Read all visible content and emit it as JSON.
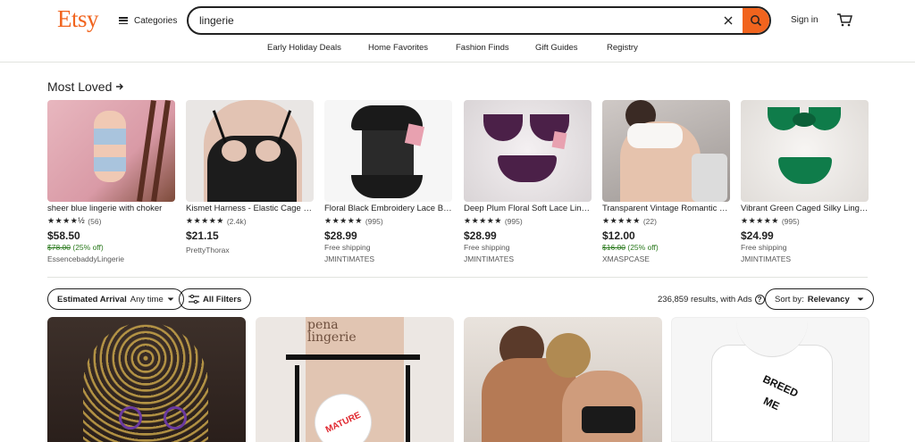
{
  "header": {
    "logo": "Etsy",
    "categories_label": "Categories",
    "search_value": "lingerie",
    "signin_label": "Sign in",
    "nav": [
      "Early Holiday Deals",
      "Home Favorites",
      "Fashion Finds",
      "Gift Guides",
      "Registry"
    ]
  },
  "most_loved": {
    "title": "Most Loved",
    "items": [
      {
        "title": "sheer blue lingerie with choker",
        "stars": "★★★★½",
        "reviews": "(56)",
        "price": "$58.50",
        "original_price": "$78.00",
        "discount": "(25% off)",
        "shipping": "",
        "shop": "EssencebaddyLingerie"
      },
      {
        "title": "Kismet Harness - Elastic Cage Bra",
        "stars": "★★★★★",
        "reviews": "(2.4k)",
        "price": "$21.15",
        "original_price": "",
        "discount": "",
        "shipping": "",
        "shop": "PrettyThorax"
      },
      {
        "title": "Floral Black Embroidery Lace Bodysuit",
        "stars": "★★★★★",
        "reviews": "(995)",
        "price": "$28.99",
        "original_price": "",
        "discount": "",
        "shipping": "Free shipping",
        "shop": "JMINTIMATES"
      },
      {
        "title": "Deep Plum Floral Soft Lace Lingerie Set",
        "stars": "★★★★★",
        "reviews": "(995)",
        "price": "$28.99",
        "original_price": "",
        "discount": "",
        "shipping": "Free shipping",
        "shop": "JMINTIMATES"
      },
      {
        "title": "Transparent Vintage Romantic Set",
        "stars": "★★★★★",
        "reviews": "(22)",
        "price": "$12.00",
        "original_price": "$16.00",
        "discount": "(25% off)",
        "shipping": "",
        "shop": "XMASPCASE"
      },
      {
        "title": "Vibrant Green Caged Silky Lingerie",
        "stars": "★★★★★",
        "reviews": "(995)",
        "price": "$24.99",
        "original_price": "",
        "discount": "",
        "shipping": "Free shipping",
        "shop": "JMINTIMATES"
      }
    ]
  },
  "filters": {
    "estimated_arrival_label": "Estimated Arrival",
    "estimated_arrival_value": "Any time",
    "all_filters_label": "All Filters",
    "results_text": "236,859 results, with Ads",
    "sort_label": "Sort by:",
    "sort_value": "Relevancy"
  },
  "grid": {
    "item2_overlay": "pena lingerie",
    "item2_badge": "MATURE",
    "item4_text": "BREED ME"
  },
  "colors": {
    "brand": "#F1641E",
    "sale_green": "#2b7a1e"
  },
  "icons": [
    "hamburger-icon",
    "close-icon",
    "search-icon",
    "cart-icon",
    "arrow-right-icon",
    "chevron-down-icon",
    "filter-icon",
    "help-icon"
  ]
}
